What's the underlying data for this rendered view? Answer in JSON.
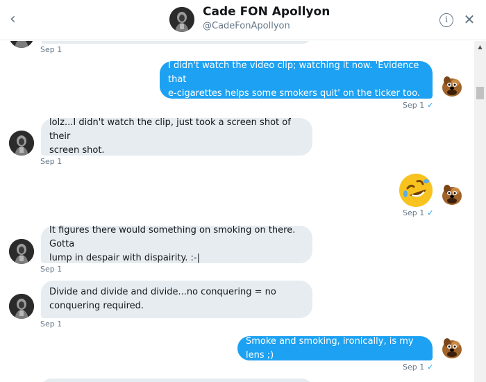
{
  "header": {
    "name": "Cade FON Apollyon",
    "handle": "@CadeFonApollyon"
  },
  "icons": {
    "back": "back-chevron-icon",
    "info": "info-icon",
    "close": "close-icon",
    "emoji": "rolling-on-floor-laughing-emoji"
  },
  "messages": [
    {
      "direction": "incoming",
      "timestamp": "Sep 1"
    },
    {
      "direction": "outgoing",
      "lines": [
        "I didn't watch the video clip; watching it now. 'Evidence that",
        "e-cigarettes helps some smokers quit' on the ticker too."
      ],
      "timestamp": "Sep 1"
    },
    {
      "direction": "incoming",
      "lines": [
        "lolz...I didn't watch the clip, just took a screen shot of their",
        "screen shot."
      ],
      "timestamp": "Sep 1"
    },
    {
      "direction": "outgoing",
      "emoji": "rolling-on-floor-laughing",
      "timestamp": "Sep 1"
    },
    {
      "direction": "incoming",
      "lines": [
        "It figures there would something on smoking on there. Gotta",
        "lump in despair with dispairity. :-|"
      ],
      "timestamp": "Sep 1"
    },
    {
      "direction": "incoming",
      "lines": [
        "Divide and divide and divide...no conquering = no",
        "conquering required."
      ],
      "timestamp": "Sep 1"
    },
    {
      "direction": "outgoing",
      "lines": [
        "Smoke and smoking, ironically, is my lens ;)"
      ],
      "timestamp": "Sep 1"
    }
  ],
  "colors": {
    "outgoing_bubble": "#1da1f2",
    "incoming_bubble": "#e6ecf0",
    "read_check": "#1da1f2"
  }
}
